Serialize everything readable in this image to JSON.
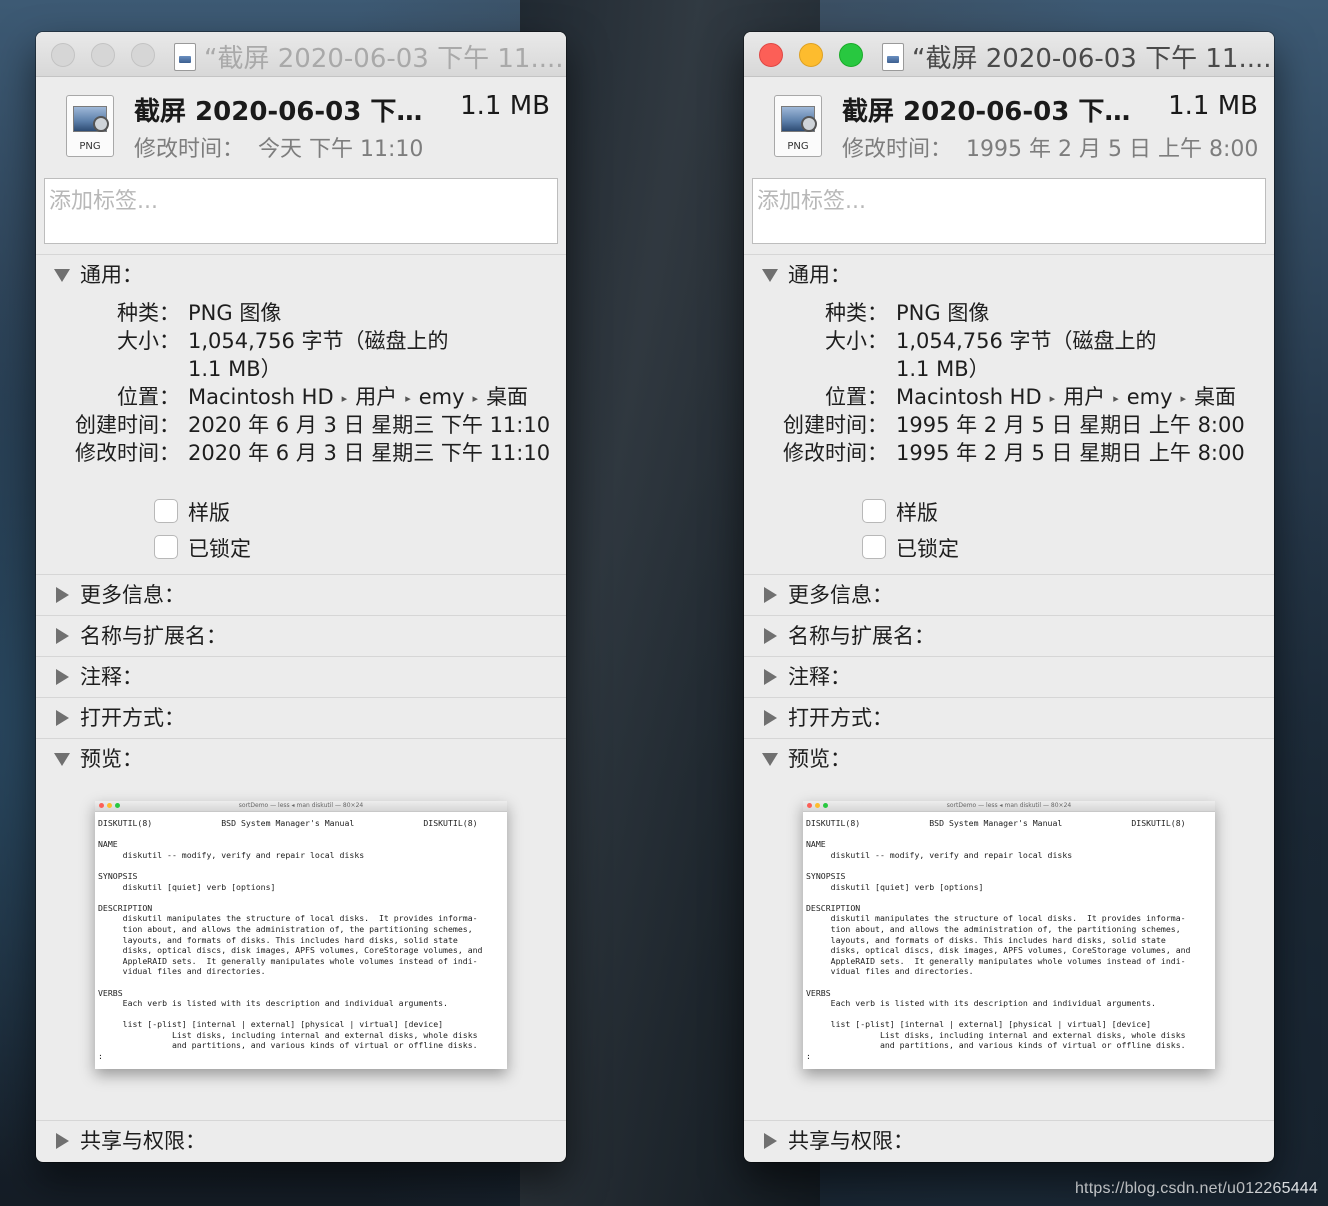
{
  "watermark": "https://blog.csdn.net/u012265444",
  "windows": [
    {
      "id": "left",
      "state": "inactive",
      "title": "“截屏 2020-06-03 下午 11....",
      "file_name": "截屏 2020-06-03 下午 1...",
      "file_size": "1.1 MB",
      "modified_label": "修改时间：",
      "modified_value": "今天 下午 11:10",
      "file_type_badge": "PNG",
      "tags_placeholder": "添加标签...",
      "general": {
        "header": "通用：",
        "kind_label": "种类：",
        "kind_value": "PNG 图像",
        "size_label": "大小：",
        "size_value_line1": "1,054,756 字节（磁盘上的",
        "size_value_line2": "1.1 MB）",
        "where_label": "位置：",
        "where_path": [
          "Macintosh HD",
          "用户",
          "emy",
          "桌面"
        ],
        "created_label": "创建时间：",
        "created_value": "2020 年 6 月 3 日 星期三 下午 11:10",
        "modified_label": "修改时间：",
        "modified_value": "2020 年 6 月 3 日 星期三 下午 11:10",
        "stationery_label": "样版",
        "locked_label": "已锁定"
      },
      "sections": [
        "更多信息：",
        "名称与扩展名：",
        "注释：",
        "打开方式："
      ],
      "preview_label": "预览：",
      "sharing_label": "共享与权限："
    },
    {
      "id": "right",
      "state": "active",
      "title": "“截屏 2020-06-03 下午 11....",
      "file_name": "截屏 2020-06-03 下午 1...",
      "file_size": "1.1 MB",
      "modified_label": "修改时间：",
      "modified_value": "1995 年 2 月 5 日 上午 8:00",
      "file_type_badge": "PNG",
      "tags_placeholder": "添加标签...",
      "general": {
        "header": "通用：",
        "kind_label": "种类：",
        "kind_value": "PNG 图像",
        "size_label": "大小：",
        "size_value_line1": "1,054,756 字节（磁盘上的",
        "size_value_line2": "1.1 MB）",
        "where_label": "位置：",
        "where_path": [
          "Macintosh HD",
          "用户",
          "emy",
          "桌面"
        ],
        "created_label": "创建时间：",
        "created_value": "1995 年 2 月 5 日 星期日 上午 8:00",
        "modified_label": "修改时间：",
        "modified_value": "1995 年 2 月 5 日 星期日 上午 8:00",
        "stationery_label": "样版",
        "locked_label": "已锁定"
      },
      "sections": [
        "更多信息：",
        "名称与扩展名：",
        "注释：",
        "打开方式："
      ],
      "preview_label": "预览：",
      "sharing_label": "共享与权限："
    }
  ],
  "preview_terminal": {
    "title": "sortDemo — less ◂ man diskutil — 80×24",
    "lines": [
      "DISKUTIL(8)              BSD System Manager's Manual              DISKUTIL(8)",
      "",
      "NAME",
      "     diskutil -- modify, verify and repair local disks",
      "",
      "SYNOPSIS",
      "     diskutil [quiet] verb [options]",
      "",
      "DESCRIPTION",
      "     diskutil manipulates the structure of local disks.  It provides informa-",
      "     tion about, and allows the administration of, the partitioning schemes,",
      "     layouts, and formats of disks. This includes hard disks, solid state",
      "     disks, optical discs, disk images, APFS volumes, CoreStorage volumes, and",
      "     AppleRAID sets.  It generally manipulates whole volumes instead of indi-",
      "     vidual files and directories.",
      "",
      "VERBS",
      "     Each verb is listed with its description and individual arguments.",
      "",
      "     list [-plist] [internal | external] [physical | virtual] [device]",
      "               List disks, including internal and external disks, whole disks",
      "               and partitions, and various kinds of virtual or offline disks.",
      ":"
    ]
  }
}
